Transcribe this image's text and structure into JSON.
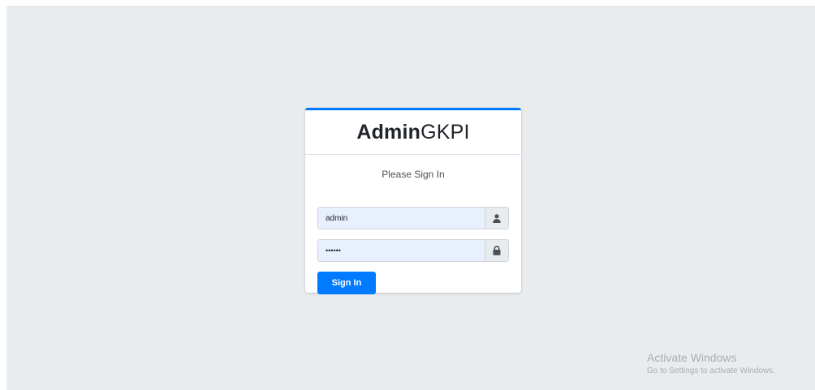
{
  "login": {
    "logo_bold": "Admin",
    "logo_light": "GKPI",
    "message": "Please Sign In",
    "username": {
      "value": "admin",
      "icon": "user-icon"
    },
    "password": {
      "value": "••••••",
      "icon": "lock-icon"
    },
    "submit_label": "Sign In"
  },
  "watermark": {
    "title": "Activate Windows",
    "subtitle": "Go to Settings to activate Windows."
  },
  "colors": {
    "accent": "#007bff",
    "page_background": "#e9ecef",
    "autofill_background": "#e8f0fe"
  }
}
